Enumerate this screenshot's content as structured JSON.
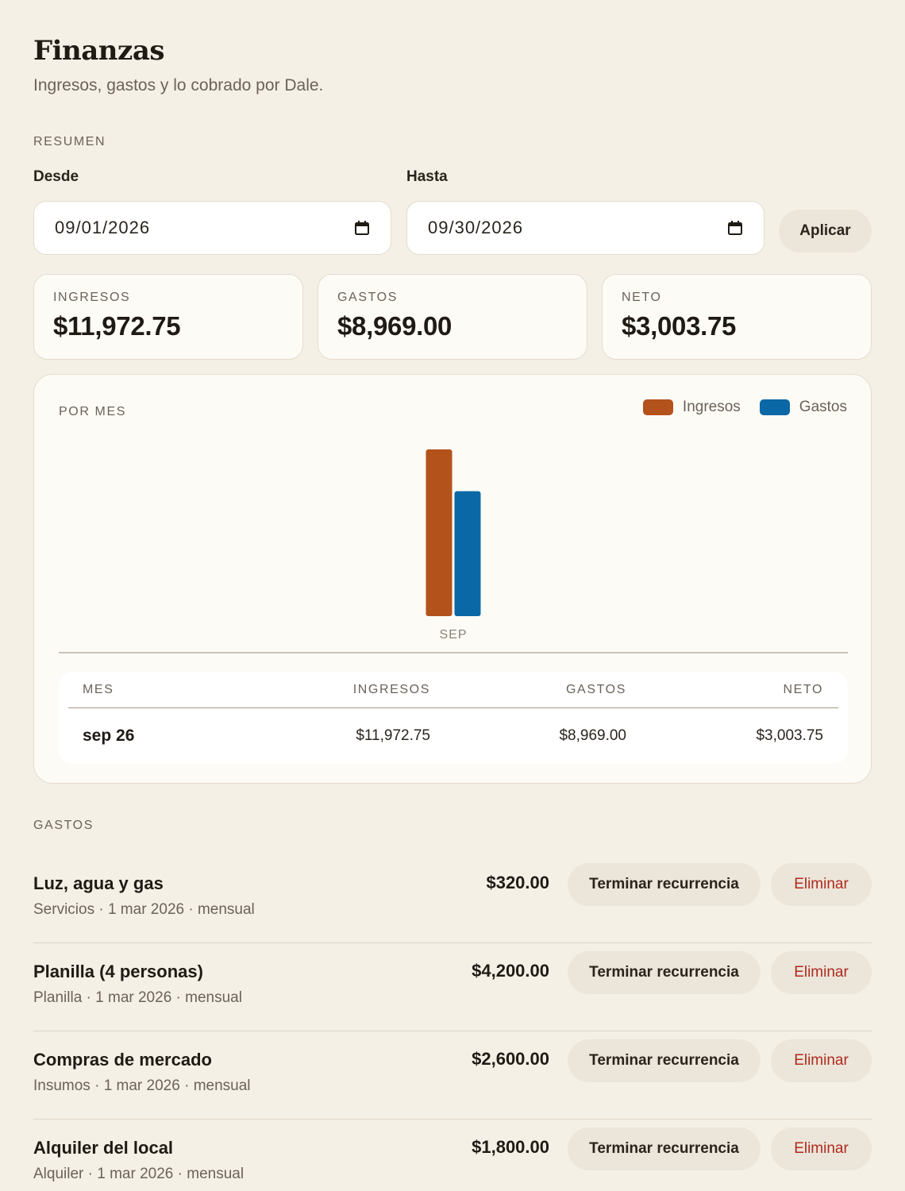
{
  "page": {
    "title": "Finanzas",
    "subtitle": "Ingresos, gastos y lo cobrado por Dale."
  },
  "summary": {
    "section_label": "RESUMEN",
    "from_label": "Desde",
    "from_value": "09/01/2026",
    "to_label": "Hasta",
    "to_value": "09/30/2026",
    "apply_label": "Aplicar"
  },
  "stats": [
    {
      "label": "INGRESOS",
      "amount": "$11,972.75"
    },
    {
      "label": "GASTOS",
      "amount": "$8,969.00"
    },
    {
      "label": "NETO",
      "amount": "$3,003.75"
    }
  ],
  "chart_card": {
    "title": "POR MES",
    "legend": [
      {
        "label": "Ingresos",
        "color": "#b4521c"
      },
      {
        "label": "Gastos",
        "color": "#0a68a6"
      }
    ]
  },
  "chart_data": {
    "type": "bar",
    "categories": [
      "SEP"
    ],
    "series": [
      {
        "name": "Ingresos",
        "values": [
          11972.75
        ],
        "color": "#b4521c"
      },
      {
        "name": "Gastos",
        "values": [
          8969.0
        ],
        "color": "#0a68a6"
      }
    ],
    "xlabel": "",
    "ylabel": "",
    "grid": false,
    "legend_position": "top-right"
  },
  "table": {
    "headers": [
      "MES",
      "INGRESOS",
      "GASTOS",
      "NETO"
    ],
    "rows": [
      {
        "mes": "sep 26",
        "ingresos": "$11,972.75",
        "gastos": "$8,969.00",
        "neto": "$3,003.75"
      }
    ]
  },
  "expenses": {
    "section_label": "GASTOS",
    "terminate_label": "Terminar recurrencia",
    "delete_label": "Eliminar",
    "items": [
      {
        "name": "Luz, agua y gas",
        "meta": "Servicios · 1 mar 2026 · mensual",
        "amount": "$320.00"
      },
      {
        "name": "Planilla (4 personas)",
        "meta": "Planilla · 1 mar 2026 · mensual",
        "amount": "$4,200.00"
      },
      {
        "name": "Compras de mercado",
        "meta": "Insumos · 1 mar 2026 · mensual",
        "amount": "$2,600.00"
      },
      {
        "name": "Alquiler del local",
        "meta": "Alquiler · 1 mar 2026 · mensual",
        "amount": "$1,800.00"
      }
    ]
  }
}
